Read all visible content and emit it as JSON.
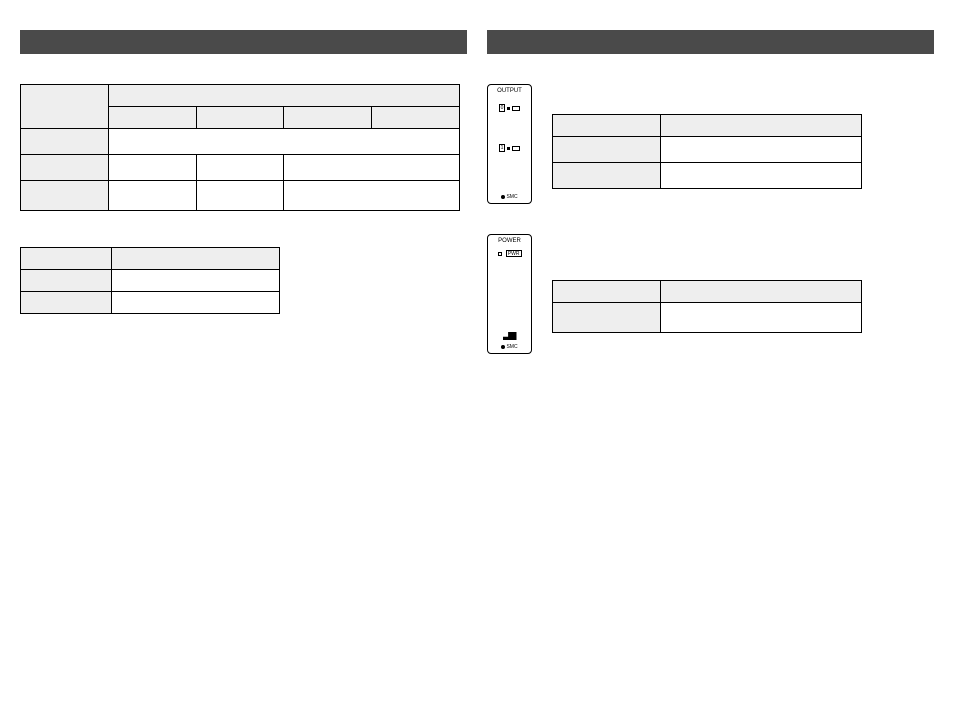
{
  "left": {
    "header": "",
    "table1_title": "",
    "table1": {
      "row1": {
        "c1": "",
        "c2_span": ""
      },
      "row2": {
        "c1": "",
        "c2": "",
        "c3": "",
        "c4": "",
        "c5": ""
      },
      "row3": {
        "c1": "",
        "c2_span": ""
      },
      "row4": {
        "c1": "",
        "c2": "",
        "c3": "",
        "c4_span": ""
      },
      "row5": {
        "c1": "",
        "c2": "",
        "c3": "",
        "c4_span": ""
      }
    },
    "table2_title": "",
    "table2": {
      "row1": {
        "c1": "",
        "c2": ""
      },
      "row2": {
        "c1": "",
        "c2": ""
      },
      "row3": {
        "c1": "",
        "c2": ""
      }
    }
  },
  "right": {
    "header": "",
    "device1": {
      "title": "OUTPUT",
      "led0": "0",
      "led1": "1",
      "brand": "SMC"
    },
    "table3": {
      "row1": {
        "c1": "",
        "c2": ""
      },
      "row2": {
        "c1": "",
        "c2": ""
      },
      "row3": {
        "c1": "",
        "c2": ""
      }
    },
    "device2": {
      "title": "POWER",
      "pwr": "PWR",
      "brand": "SMC"
    },
    "table4": {
      "row1": {
        "c1": "",
        "c2": ""
      },
      "row2": {
        "c1": "",
        "c2": ""
      }
    }
  }
}
